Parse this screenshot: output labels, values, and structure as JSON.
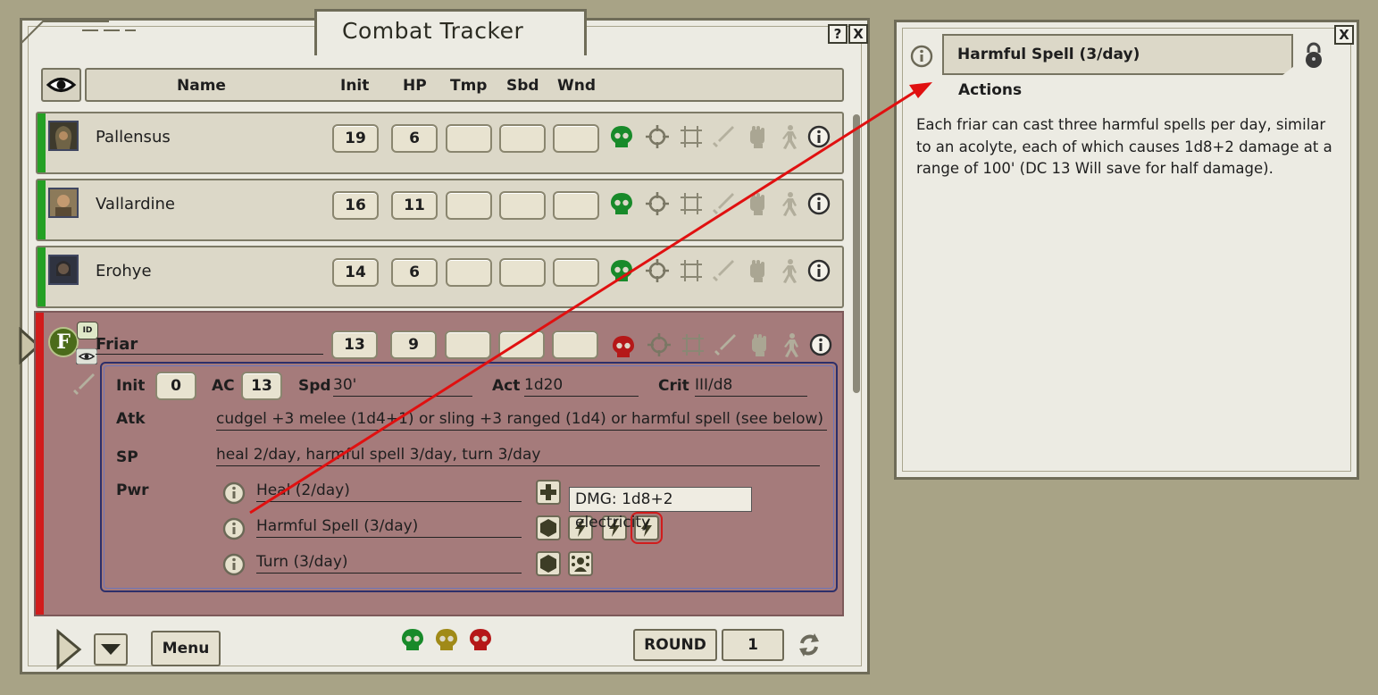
{
  "combat_tracker": {
    "title": "Combat Tracker",
    "help_label": "?",
    "close_label": "X",
    "columns": [
      "Name",
      "Init",
      "HP",
      "Tmp",
      "Sbd",
      "Wnd"
    ],
    "rows": [
      {
        "name": "Pallensus",
        "init": "19",
        "hp": "6"
      },
      {
        "name": "Vallardine",
        "init": "16",
        "hp": "11"
      },
      {
        "name": "Erohye",
        "init": "14",
        "hp": "6"
      }
    ],
    "active": {
      "token_letter": "F",
      "id_badge": "ID",
      "name": "Friar",
      "init": "13",
      "hp": "9",
      "stats": {
        "init_label": "Init",
        "init_value": "0",
        "ac_label": "AC",
        "ac_value": "13",
        "spd_label": "Spd",
        "spd_value": "30'",
        "act_label": "Act",
        "act_value": "1d20",
        "crit_label": "Crit",
        "crit_value": "III/d8"
      },
      "atk_label": "Atk",
      "atk_value": "cudgel +3 melee (1d4+1) or sling +3 ranged (1d4) or harmful spell (see below)",
      "sp_label": "SP",
      "sp_value": "heal 2/day, harmful spell 3/day, turn 3/day",
      "pwr_label": "Pwr",
      "powers": [
        "Heal (2/day)",
        "Harmful Spell (3/day)",
        "Turn (3/day)"
      ]
    },
    "tooltip": "DMG: 1d8+2 electricity",
    "footer": {
      "menu_label": "Menu",
      "round_label": "ROUND",
      "round_value": "1"
    },
    "colors": {
      "friendly": "#24a024",
      "hostile": "#d11c1c",
      "neutral": "#a08a18"
    }
  },
  "power_window": {
    "title": "Harmful Spell (3/day)",
    "section": "Actions",
    "close_label": "X",
    "description": "Each friar can cast three harmful spells per day, similar to an acolyte, each of which causes 1d8+2 damage at a range of 100' (DC 13 Will save for half damage)."
  }
}
